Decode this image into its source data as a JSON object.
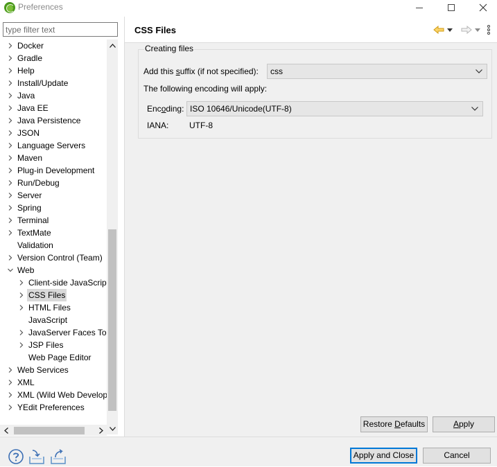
{
  "window": {
    "title": "Preferences"
  },
  "filter": {
    "placeholder": "type filter text",
    "value": ""
  },
  "tree": {
    "items": [
      {
        "label": "Docker",
        "level": 0,
        "expandable": true,
        "expanded": false
      },
      {
        "label": "Gradle",
        "level": 0,
        "expandable": true,
        "expanded": false
      },
      {
        "label": "Help",
        "level": 0,
        "expandable": true,
        "expanded": false
      },
      {
        "label": "Install/Update",
        "level": 0,
        "expandable": true,
        "expanded": false
      },
      {
        "label": "Java",
        "level": 0,
        "expandable": true,
        "expanded": false
      },
      {
        "label": "Java EE",
        "level": 0,
        "expandable": true,
        "expanded": false
      },
      {
        "label": "Java Persistence",
        "level": 0,
        "expandable": true,
        "expanded": false
      },
      {
        "label": "JSON",
        "level": 0,
        "expandable": true,
        "expanded": false
      },
      {
        "label": "Language Servers",
        "level": 0,
        "expandable": true,
        "expanded": false
      },
      {
        "label": "Maven",
        "level": 0,
        "expandable": true,
        "expanded": false
      },
      {
        "label": "Plug-in Development",
        "level": 0,
        "expandable": true,
        "expanded": false
      },
      {
        "label": "Run/Debug",
        "level": 0,
        "expandable": true,
        "expanded": false
      },
      {
        "label": "Server",
        "level": 0,
        "expandable": true,
        "expanded": false
      },
      {
        "label": "Spring",
        "level": 0,
        "expandable": true,
        "expanded": false
      },
      {
        "label": "Terminal",
        "level": 0,
        "expandable": true,
        "expanded": false
      },
      {
        "label": "TextMate",
        "level": 0,
        "expandable": true,
        "expanded": false
      },
      {
        "label": "Validation",
        "level": 0,
        "expandable": false,
        "expanded": false
      },
      {
        "label": "Version Control (Team)",
        "level": 0,
        "expandable": true,
        "expanded": false
      },
      {
        "label": "Web",
        "level": 0,
        "expandable": true,
        "expanded": true
      },
      {
        "label": "Client-side JavaScript",
        "level": 1,
        "expandable": true,
        "expanded": false
      },
      {
        "label": "CSS Files",
        "level": 1,
        "expandable": true,
        "expanded": false,
        "selected": true
      },
      {
        "label": "HTML Files",
        "level": 1,
        "expandable": true,
        "expanded": false
      },
      {
        "label": "JavaScript",
        "level": 1,
        "expandable": false,
        "expanded": false
      },
      {
        "label": "JavaServer Faces Tools",
        "level": 1,
        "expandable": true,
        "expanded": false
      },
      {
        "label": "JSP Files",
        "level": 1,
        "expandable": true,
        "expanded": false
      },
      {
        "label": "Web Page Editor",
        "level": 1,
        "expandable": false,
        "expanded": false
      },
      {
        "label": "Web Services",
        "level": 0,
        "expandable": true,
        "expanded": false
      },
      {
        "label": "XML",
        "level": 0,
        "expandable": true,
        "expanded": false
      },
      {
        "label": "XML (Wild Web Developer)",
        "level": 0,
        "expandable": true,
        "expanded": false
      },
      {
        "label": "YEdit Preferences",
        "level": 0,
        "expandable": true,
        "expanded": false
      }
    ]
  },
  "page": {
    "title": "CSS Files",
    "group_title": "Creating files",
    "suffix_label": "Add this suffix (if not specified):",
    "suffix_value": "css",
    "encoding_note": "The following encoding will apply:",
    "encoding_label": "Encoding:",
    "encoding_value": "ISO 10646/Unicode(UTF-8)",
    "iana_label": "IANA:",
    "iana_value": "UTF-8"
  },
  "buttons": {
    "restore_defaults": "Restore Defaults",
    "apply": "Apply",
    "apply_and_close": "Apply and Close",
    "cancel": "Cancel"
  },
  "icons": {
    "back": "back-arrow-icon",
    "forward": "forward-arrow-icon",
    "menu": "view-menu-icon",
    "help": "help-icon",
    "import": "import-icon",
    "export": "export-icon"
  },
  "colors": {
    "back_arrow": "#e8a317",
    "help": "#3c6fb4",
    "default_button_border": "#0078d7"
  }
}
